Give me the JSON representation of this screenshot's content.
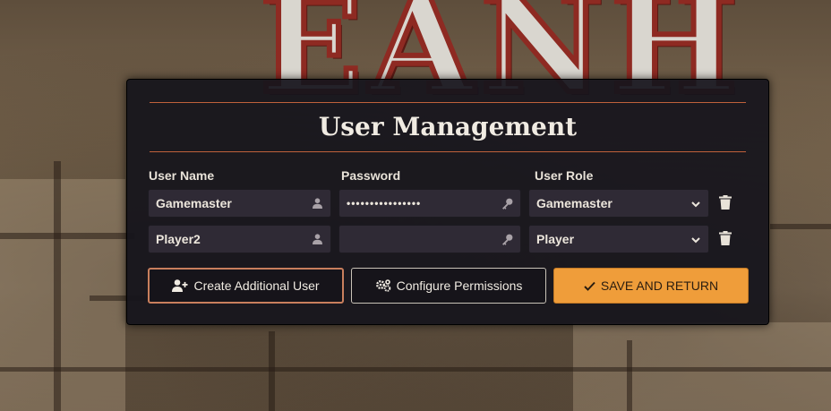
{
  "dialog": {
    "title": "User Management",
    "columns": {
      "user_name": "User Name",
      "password": "Password",
      "user_role": "User Role"
    },
    "users": [
      {
        "name": "Gamemaster",
        "password_mask": "••••••••••••••••",
        "role": "Gamemaster"
      },
      {
        "name": "Player2",
        "password_mask": "",
        "role": "Player"
      }
    ],
    "buttons": {
      "create_user": "Create Additional User",
      "configure_permissions": "Configure Permissions",
      "save_return": "SAVE AND RETURN"
    }
  },
  "colors": {
    "accent_orange": "#ef9d3a",
    "rule": "#c0613b",
    "field_bg": "#2f2a35",
    "dialog_bg": "#16141c"
  },
  "icons": {
    "user_field": "user-icon",
    "password_field": "key-icon",
    "select": "chevron-down-icon",
    "delete": "trash-icon",
    "create_user": "user-plus-icon",
    "configure_permissions": "cogs-icon",
    "save_return": "check-icon"
  }
}
